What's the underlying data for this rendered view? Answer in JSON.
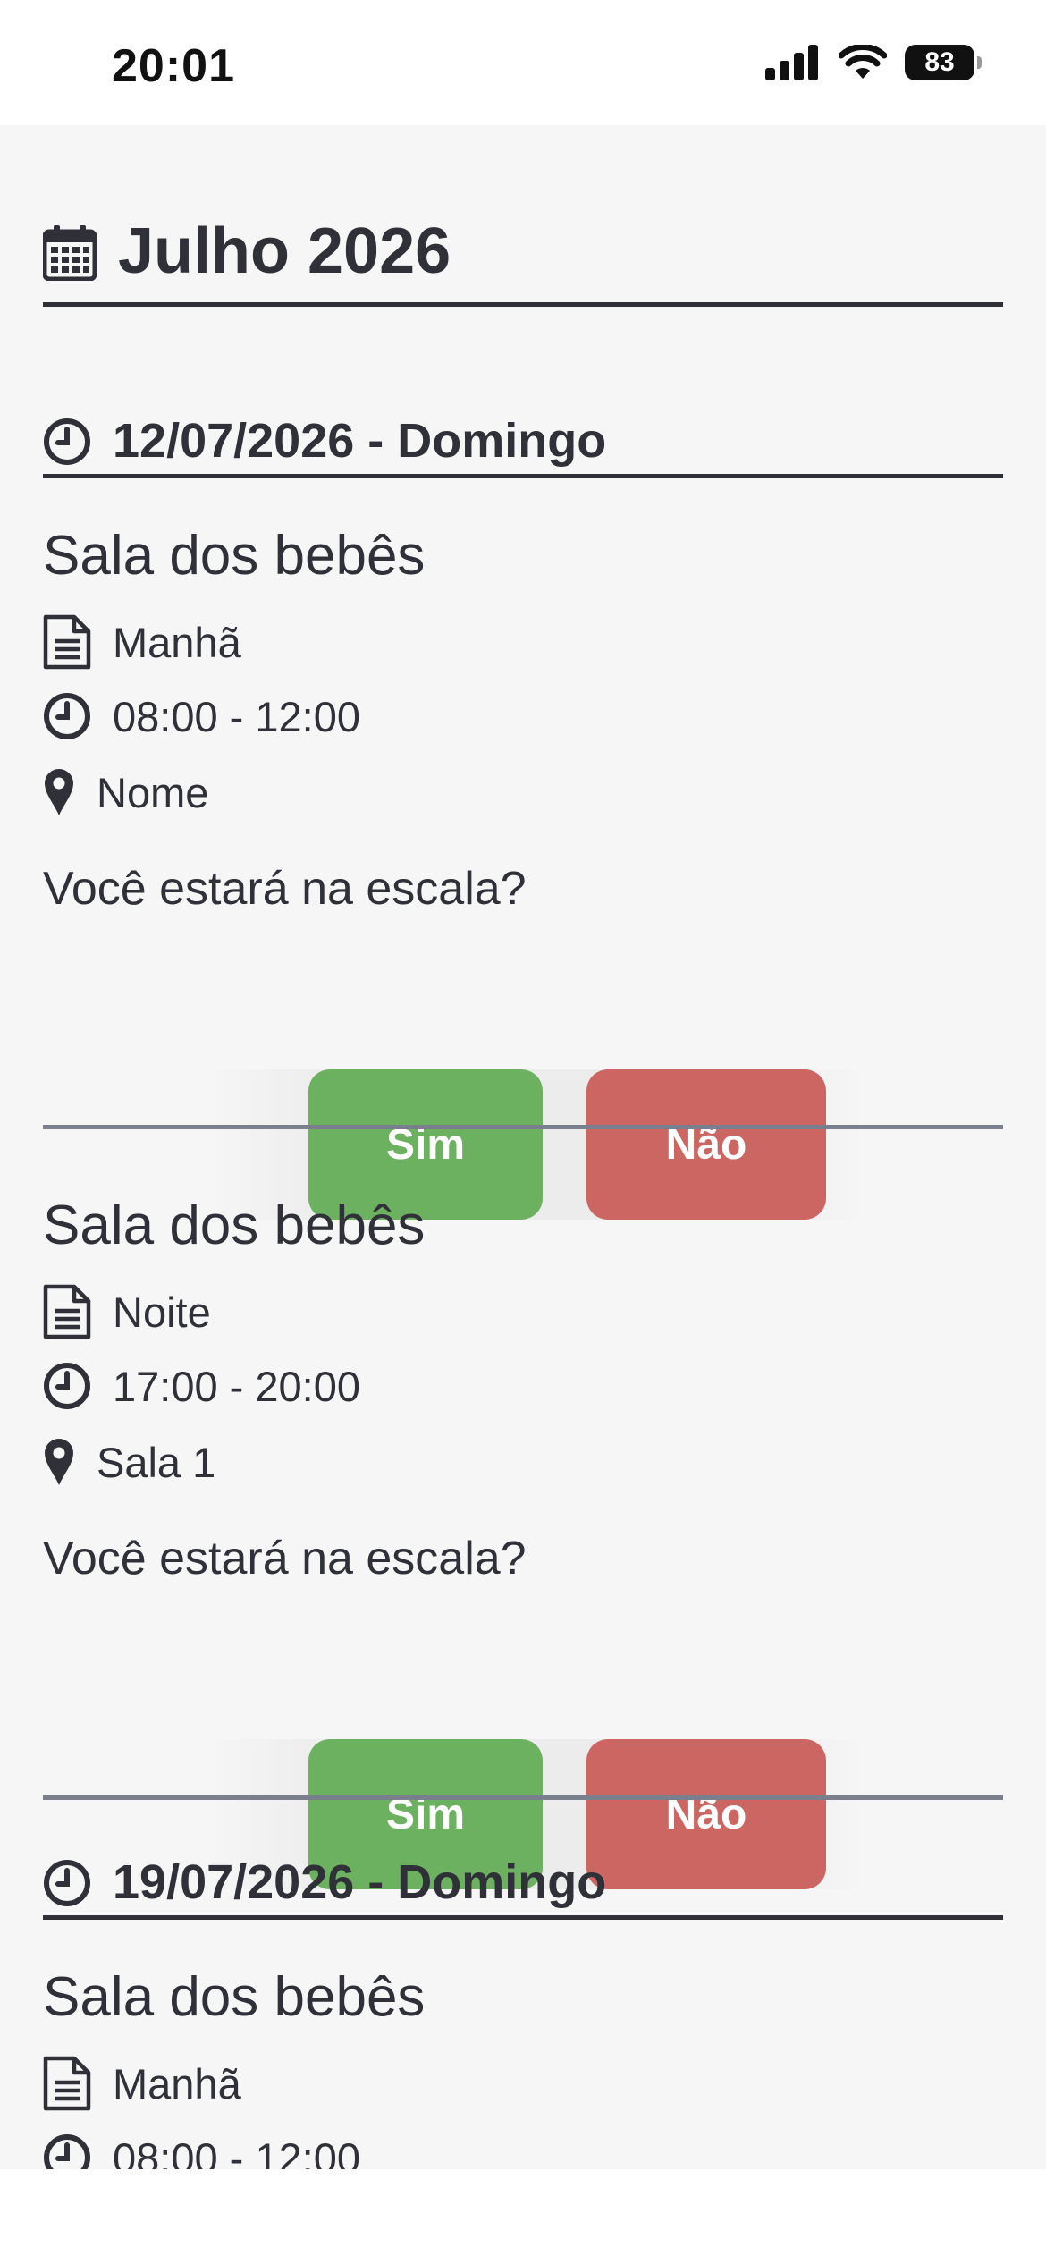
{
  "status_bar": {
    "time": "20:01",
    "battery": "83"
  },
  "month": {
    "title": "Julho 2026",
    "icon": "calendar-icon"
  },
  "days": [
    {
      "title": "12/07/2026 - Domingo",
      "slots": [
        {
          "title": "Sala dos bebês",
          "period": "Manhã",
          "time": "08:00 - 12:00",
          "location": "Nome",
          "question": "Você estará na escala?",
          "yes_label": "Sim",
          "no_label": "Não"
        },
        {
          "title": "Sala dos bebês",
          "period": "Noite",
          "time": "17:00 - 20:00",
          "location": "Sala 1",
          "question": "Você estará na escala?",
          "yes_label": "Sim",
          "no_label": "Não"
        }
      ]
    },
    {
      "title": "19/07/2026 - Domingo",
      "slots": [
        {
          "title": "Sala dos bebês",
          "period": "Manhã",
          "time": "08:00 - 12:00"
        }
      ]
    }
  ],
  "colors": {
    "yes": "#6cb15f",
    "no": "#cc6663",
    "text": "#2f3038",
    "background": "#f6f6f6"
  }
}
